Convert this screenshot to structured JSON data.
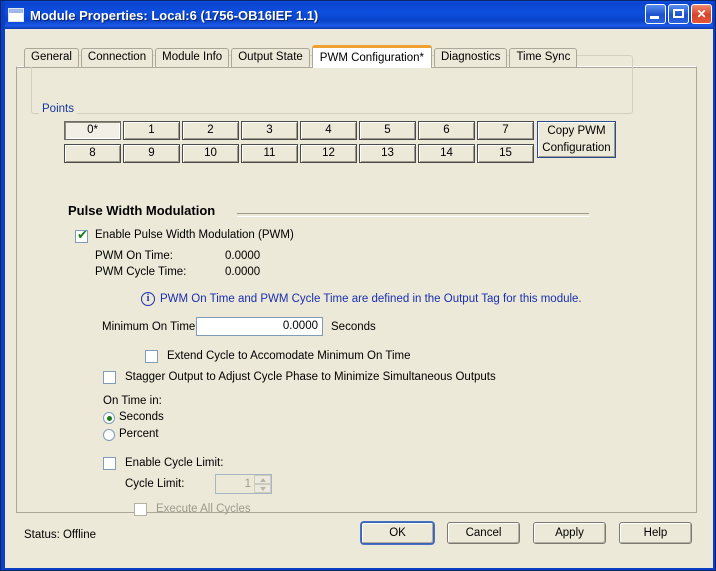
{
  "window": {
    "title": "Module Properties: Local:6 (1756-OB16IEF 1.1)",
    "icon": "module-icon",
    "minimize_label": "_",
    "maximize_label": "□",
    "close_label": "✕"
  },
  "tabs": [
    {
      "label": "General",
      "active": false
    },
    {
      "label": "Connection",
      "active": false
    },
    {
      "label": "Module Info",
      "active": false
    },
    {
      "label": "Output State",
      "active": false
    },
    {
      "label": "PWM Configuration*",
      "active": true
    },
    {
      "label": "Diagnostics",
      "active": false
    },
    {
      "label": "Time Sync",
      "active": false
    }
  ],
  "points": {
    "legend": "Points",
    "buttons": [
      "0*",
      "1",
      "2",
      "3",
      "4",
      "5",
      "6",
      "7",
      "8",
      "9",
      "10",
      "11",
      "12",
      "13",
      "14",
      "15"
    ],
    "selected": "0*",
    "copy_button_line1": "Copy PWM",
    "copy_button_line2": "Configuration"
  },
  "pwm": {
    "section_title": "Pulse Width Modulation",
    "enable_label": "Enable Pulse Width Modulation (PWM)",
    "enable_checked": true,
    "on_time_label": "PWM On Time:",
    "on_time_value": "0.0000",
    "cycle_time_label": "PWM Cycle Time:",
    "cycle_time_value": "0.0000",
    "info_icon": "info-icon",
    "info_glyph": "i",
    "info_text": "PWM On Time and PWM Cycle Time are defined in the Output Tag for this module.",
    "minimum_on_time_label": "Minimum On Time:",
    "minimum_on_time_value": "0.0000",
    "minimum_on_time_units": "Seconds",
    "extend_cycle_label": "Extend Cycle to Accomodate Minimum On Time",
    "extend_cycle_checked": false,
    "stagger_label": "Stagger Output to Adjust Cycle Phase to Minimize Simultaneous  Outputs",
    "stagger_checked": false,
    "on_time_in_label": "On Time in:",
    "radio_seconds": "Seconds",
    "radio_percent": "Percent",
    "radio_selected": "Seconds",
    "enable_cycle_limit_label": "Enable Cycle Limit:",
    "enable_cycle_limit_checked": false,
    "cycle_limit_label": "Cycle Limit:",
    "cycle_limit_value": "1",
    "execute_all_cycles_label": "Execute All Cycles",
    "execute_all_cycles_checked": false
  },
  "footer": {
    "status_label": "Status:",
    "status_value": "Offline",
    "status_full": "Status:  Offline",
    "ok": "OK",
    "cancel": "Cancel",
    "apply": "Apply",
    "help": "Help"
  },
  "colors": {
    "title_blue": "#0b43c9",
    "face": "#ece9d8",
    "active_tab_accent": "#f0a030",
    "link_blue": "#1a2fb0",
    "legend_blue": "#1536a0",
    "check_green": "#1a7a1a"
  }
}
